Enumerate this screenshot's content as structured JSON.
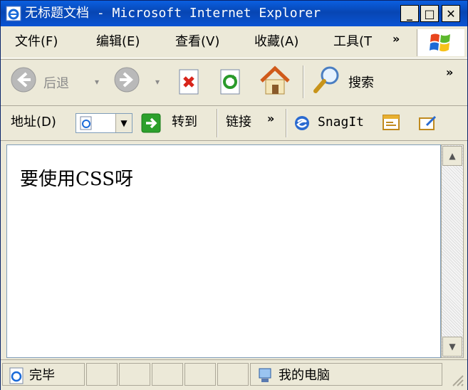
{
  "window": {
    "title": "无标题文档 - Microsoft Internet Explorer",
    "minimize": "_",
    "maximize": "□",
    "close": "✕"
  },
  "menu": {
    "items": [
      "文件(F)",
      "编辑(E)",
      "查看(V)",
      "收藏(A)",
      "工具(T"
    ],
    "overflow": "»"
  },
  "toolbar": {
    "back_label": "后退",
    "search_label": "搜索",
    "overflow": "»",
    "icons": [
      "back-icon",
      "forward-icon",
      "stop-icon",
      "refresh-icon",
      "home-icon",
      "search-icon"
    ]
  },
  "address": {
    "label": "地址(D)",
    "go_label": "转到",
    "links_label": "链接",
    "links_overflow": "»",
    "snagit_label": "SnagIt"
  },
  "content": {
    "text": "要使用CSS呀"
  },
  "status": {
    "text": "完毕",
    "zone": "我的电脑"
  },
  "colors": {
    "titlebar": "#0a53d3",
    "chrome": "#ece9d8",
    "go_green": "#2ca02c"
  }
}
